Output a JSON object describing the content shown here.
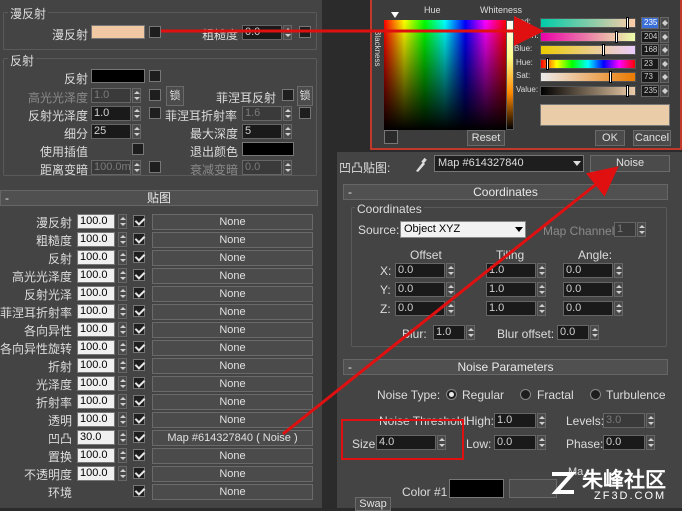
{
  "left_top": {
    "diffuse_group_title": "漫反射",
    "diffuse_label": "漫反射",
    "roughness_label": "粗糙度",
    "roughness_value": "0.0",
    "diffuse_color": "#f0c9a4"
  },
  "reflection": {
    "title": "反射",
    "reflect_label": "反射",
    "hilight_gloss_label": "高光光泽度",
    "hilight_gloss_value": "1.0",
    "lock_label": "锁",
    "fresnel_label": "菲涅耳反射",
    "lock2_label": "锁",
    "refl_gloss_label": "反射光泽度",
    "refl_gloss_value": "1.0",
    "fresnel_ior_label": "菲涅耳折射率",
    "fresnel_ior_value": "1.6",
    "subdivs_label": "细分",
    "subdivs_value": "25",
    "max_depth_label": "最大深度",
    "max_depth_value": "5",
    "use_interp_label": "使用插值",
    "exit_color_label": "退出颜色",
    "dim_dist_label": "距离变暗",
    "dim_dist_value": "100.0m",
    "dim_falloff_label": "衰减变暗",
    "dim_falloff_value": "0.0"
  },
  "maps": {
    "title": "贴图",
    "rows": [
      {
        "label": "漫反射",
        "value": "100.0",
        "map": "None"
      },
      {
        "label": "粗糙度",
        "value": "100.0",
        "map": "None"
      },
      {
        "label": "反射",
        "value": "100.0",
        "map": "None"
      },
      {
        "label": "高光光泽度",
        "value": "100.0",
        "map": "None"
      },
      {
        "label": "反射光泽",
        "value": "100.0",
        "map": "None"
      },
      {
        "label": "菲涅耳折射率",
        "value": "100.0",
        "map": "None"
      },
      {
        "label": "各向异性",
        "value": "100.0",
        "map": "None"
      },
      {
        "label": "各向异性旋转",
        "value": "100.0",
        "map": "None"
      },
      {
        "label": "折射",
        "value": "100.0",
        "map": "None"
      },
      {
        "label": "光泽度",
        "value": "100.0",
        "map": "None"
      },
      {
        "label": "折射率",
        "value": "100.0",
        "map": "None"
      },
      {
        "label": "透明",
        "value": "100.0",
        "map": "None"
      },
      {
        "label": "凹凸",
        "value": "30.0",
        "map": "Map #614327840 ( Noise )"
      },
      {
        "label": "置换",
        "value": "100.0",
        "map": "None"
      },
      {
        "label": "不透明度",
        "value": "100.0",
        "map": "None"
      },
      {
        "label": "环境",
        "value": "",
        "map": "None"
      }
    ]
  },
  "color_picker": {
    "hue_label": "Hue",
    "whiteness_label": "Whiteness",
    "blackness_label": "Blackness",
    "channels": [
      {
        "label": "Red:",
        "value": "235"
      },
      {
        "label": "Green:",
        "value": "204"
      },
      {
        "label": "Blue:",
        "value": "168"
      },
      {
        "label": "Hue:",
        "value": "23"
      },
      {
        "label": "Sat:",
        "value": "73"
      },
      {
        "label": "Value:",
        "value": "235"
      }
    ],
    "reset_label": "Reset",
    "ok_label": "OK",
    "cancel_label": "Cancel",
    "sample_color": "#ebcca8"
  },
  "bump_map": {
    "label": "凹凸贴图:",
    "map_name": "Map #614327840",
    "type_label": "Noise"
  },
  "coordinates": {
    "rollout_title": "Coordinates",
    "group_title": "Coordinates",
    "source_label": "Source:",
    "source_value": "Object XYZ",
    "map_channel_label": "Map Channel:",
    "map_channel_value": "1",
    "offset_label": "Offset",
    "tiling_label": "Tiling",
    "angle_label": "Angle:",
    "axes": [
      {
        "axis": "X:",
        "offset": "0.0",
        "tiling": "1.0",
        "angle": "0.0"
      },
      {
        "axis": "Y:",
        "offset": "0.0",
        "tiling": "1.0",
        "angle": "0.0"
      },
      {
        "axis": "Z:",
        "offset": "0.0",
        "tiling": "1.0",
        "angle": "0.0"
      }
    ],
    "blur_label": "Blur:",
    "blur_value": "1.0",
    "blur_offset_label": "Blur offset:",
    "blur_offset_value": "0.0"
  },
  "noise": {
    "rollout_title": "Noise Parameters",
    "type_label": "Noise Type:",
    "regular_label": "Regular",
    "fractal_label": "Fractal",
    "turbulence_label": "Turbulence",
    "threshold_label": "Noise Threshold:",
    "high_label": "High:",
    "high_value": "1.0",
    "levels_label": "Levels:",
    "levels_value": "3.0",
    "size_label": "Size:",
    "size_value": "4.0",
    "low_label": "Low:",
    "low_value": "0.0",
    "phase_label": "Phase:",
    "phase_value": "0.0",
    "maps_label": "Ma",
    "color1_label": "Color #1",
    "swap_label": "Swap"
  },
  "watermark": {
    "text": "朱峰社区",
    "url": "ZF3D.COM"
  }
}
